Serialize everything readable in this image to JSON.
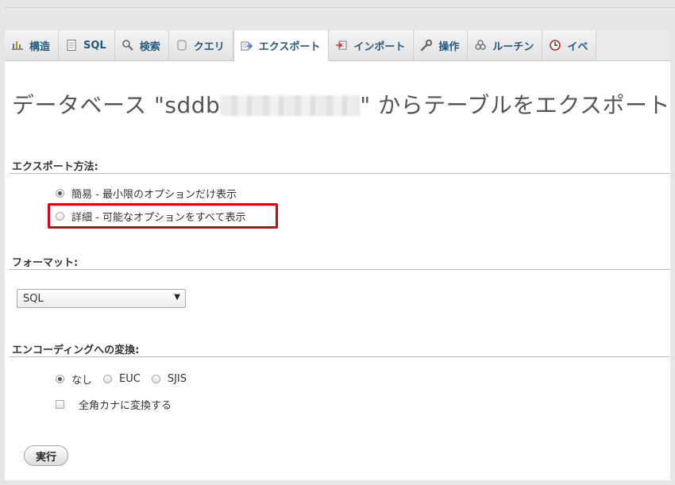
{
  "tabs": [
    {
      "label": "構造",
      "icon": "structure-icon"
    },
    {
      "label": "SQL",
      "icon": "sql-icon"
    },
    {
      "label": "検索",
      "icon": "search-icon"
    },
    {
      "label": "クエリ",
      "icon": "query-icon"
    },
    {
      "label": "エクスポート",
      "icon": "export-icon"
    },
    {
      "label": "インポート",
      "icon": "import-icon"
    },
    {
      "label": "操作",
      "icon": "wrench-icon"
    },
    {
      "label": "ルーチン",
      "icon": "routines-icon"
    },
    {
      "label": "イベ",
      "icon": "clock-icon"
    }
  ],
  "active_tab": "エクスポート",
  "title": {
    "prefix": "データベース \"sddb",
    "suffix": "\" からテーブルをエクスポート"
  },
  "export_method": {
    "label": "エクスポート方法:",
    "options": [
      {
        "label": "簡易 - 最小限のオプションだけ表示",
        "checked": true
      },
      {
        "label": "詳細 - 可能なオプションをすべて表示",
        "checked": false
      }
    ]
  },
  "format": {
    "label": "フォーマット:",
    "selected": "SQL"
  },
  "encoding": {
    "label": "エンコーディングへの変換:",
    "options": [
      {
        "label": "なし",
        "checked": true
      },
      {
        "label": "EUC",
        "checked": false
      },
      {
        "label": "SJIS",
        "checked": false
      }
    ],
    "kana_checkbox_label": "全角カナに変換する"
  },
  "execute_button": "実行",
  "colors": {
    "link_blue": "#235a81",
    "highlight_red": "#d9000d"
  }
}
